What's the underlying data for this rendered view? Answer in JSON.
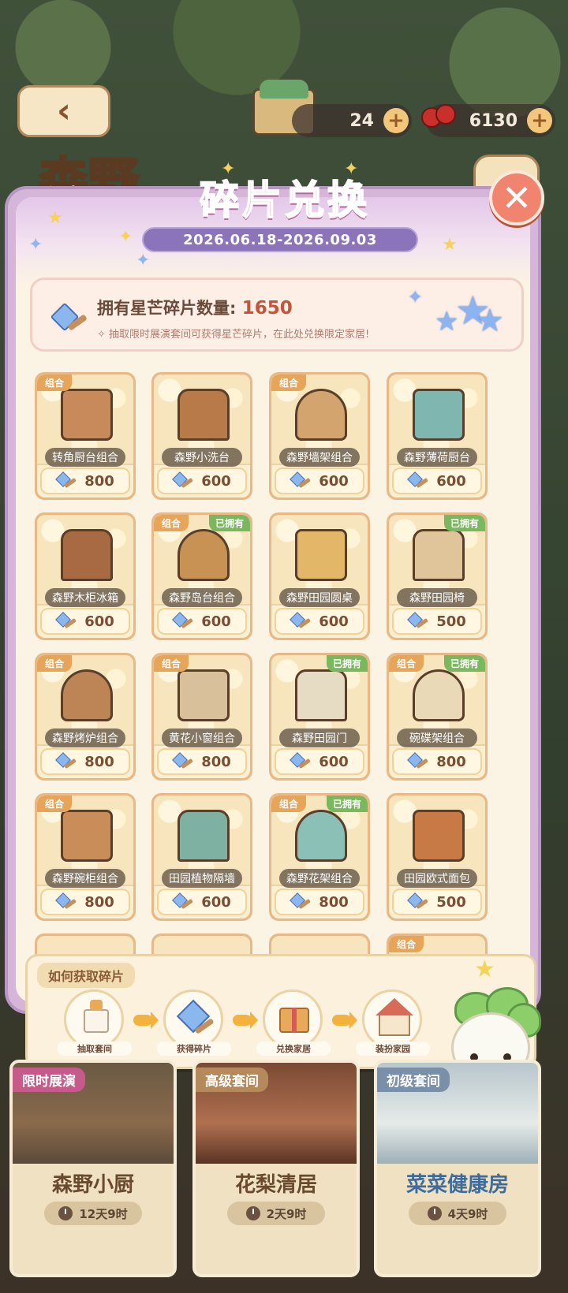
{
  "top_bar": {
    "back_icon": "back-arrow-icon",
    "bg_title": "森野",
    "currency_ticket_value": "24",
    "currency_cherry_value": "6130"
  },
  "panel": {
    "title": "碎片兑换",
    "date_range": "2026.06.18-2026.09.03",
    "shard_label": "拥有星芒碎片数量:",
    "shard_count": "1650",
    "shard_desc": "抽取限时展演套间可获得星芒碎片，在此处兑换限定家居!"
  },
  "tags": {
    "combo": "组合",
    "owned": "已拥有"
  },
  "items": [
    {
      "name": "转角厨台组合",
      "price": "800",
      "combo": true,
      "owned": false,
      "art": "kitchen-corner"
    },
    {
      "name": "森野小洗台",
      "price": "600",
      "combo": false,
      "owned": false,
      "art": "washstand"
    },
    {
      "name": "森野墙架组合",
      "price": "600",
      "combo": true,
      "owned": false,
      "art": "wall-shelf"
    },
    {
      "name": "森野薄荷厨台",
      "price": "600",
      "combo": false,
      "owned": false,
      "art": "mint-counter"
    },
    {
      "name": "森野木柜冰箱",
      "price": "600",
      "combo": false,
      "owned": false,
      "art": "fridge"
    },
    {
      "name": "森野岛台组合",
      "price": "600",
      "combo": true,
      "owned": true,
      "art": "island"
    },
    {
      "name": "森野田园圆桌",
      "price": "600",
      "combo": false,
      "owned": false,
      "art": "round-table"
    },
    {
      "name": "森野田园椅",
      "price": "500",
      "combo": false,
      "owned": true,
      "art": "chair"
    },
    {
      "name": "森野烤炉组合",
      "price": "800",
      "combo": true,
      "owned": false,
      "art": "oven"
    },
    {
      "name": "黄花小窗组合",
      "price": "800",
      "combo": true,
      "owned": false,
      "art": "window"
    },
    {
      "name": "森野田园门",
      "price": "600",
      "combo": false,
      "owned": true,
      "art": "door"
    },
    {
      "name": "碗碟架组合",
      "price": "800",
      "combo": true,
      "owned": true,
      "art": "dish-rack"
    },
    {
      "name": "森野碗柜组合",
      "price": "800",
      "combo": true,
      "owned": false,
      "art": "cupboard"
    },
    {
      "name": "田园植物隔墙",
      "price": "600",
      "combo": false,
      "owned": false,
      "art": "plant-wall"
    },
    {
      "name": "森野花架组合",
      "price": "800",
      "combo": true,
      "owned": true,
      "art": "flower-stand"
    },
    {
      "name": "田园欧式面包",
      "price": "500",
      "combo": false,
      "owned": false,
      "art": "bread"
    }
  ],
  "partial_row_tag": "组合",
  "howto": {
    "title": "如何获取碎片",
    "steps": [
      "抽取套间",
      "获得碎片",
      "兑换家居",
      "装扮家园"
    ]
  },
  "banners": [
    {
      "tag": "限时展演",
      "name": "森野小厨",
      "time": "12天9时",
      "tag_color": "#c65a8a",
      "name_color": "#6a4a2e"
    },
    {
      "tag": "高级套间",
      "name": "花梨清居",
      "time": "2天9时",
      "tag_color": "#b5895a",
      "name_color": "#6a4a2e"
    },
    {
      "tag": "初级套间",
      "name": "菜菜健康房",
      "time": "4天9时",
      "tag_color": "#7a8fa8",
      "name_color": "#3e6c9c"
    }
  ],
  "colors": {
    "panel_border": "#b995c6",
    "title_pink": "#f3a0b4",
    "date_pill": "#8c74b8",
    "close_red": "#f1846f",
    "tag_combo": "#e7a55a",
    "tag_owned": "#7ab85e"
  }
}
